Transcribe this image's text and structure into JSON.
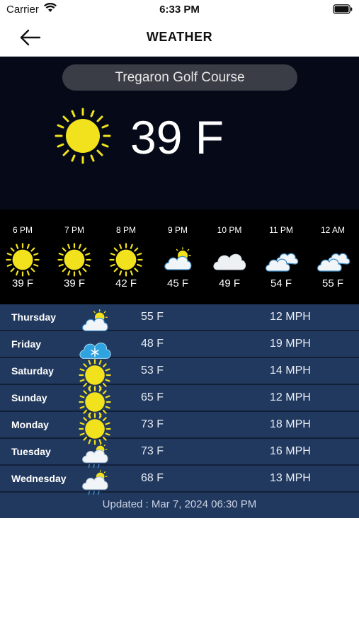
{
  "status_bar": {
    "carrier": "Carrier",
    "time": "6:33 PM"
  },
  "header": {
    "title": "WEATHER"
  },
  "current": {
    "location": "Tregaron Golf Course",
    "temperature": "39 F",
    "icon": "sun-icon"
  },
  "hourly": [
    {
      "time": "6 PM",
      "temp": "39 F",
      "icon": "sun-icon"
    },
    {
      "time": "7 PM",
      "temp": "39 F",
      "icon": "sun-icon"
    },
    {
      "time": "8 PM",
      "temp": "42 F",
      "icon": "sun-icon"
    },
    {
      "time": "9 PM",
      "temp": "45 F",
      "icon": "partly-cloudy-icon"
    },
    {
      "time": "10 PM",
      "temp": "49 F",
      "icon": "cloud-icon"
    },
    {
      "time": "11 PM",
      "temp": "54 F",
      "icon": "clouds-icon"
    },
    {
      "time": "12 AM",
      "temp": "55 F",
      "icon": "clouds-icon"
    }
  ],
  "daily": [
    {
      "day": "Thursday",
      "temp": "55 F",
      "wind": "12 MPH",
      "icon": "partly-cloudy-icon"
    },
    {
      "day": "Friday",
      "temp": "48 F",
      "wind": "19 MPH",
      "icon": "snow-cloud-icon"
    },
    {
      "day": "Saturday",
      "temp": "53 F",
      "wind": "14 MPH",
      "icon": "sun-icon"
    },
    {
      "day": "Sunday",
      "temp": "65 F",
      "wind": "12 MPH",
      "icon": "sun-icon"
    },
    {
      "day": "Monday",
      "temp": "73 F",
      "wind": "18 MPH",
      "icon": "sun-icon"
    },
    {
      "day": "Tuesday",
      "temp": "73 F",
      "wind": "16 MPH",
      "icon": "rain-partly-cloudy-icon"
    },
    {
      "day": "Wednesday",
      "temp": "68 F",
      "wind": "13 MPH",
      "icon": "rain-partly-cloudy-icon"
    }
  ],
  "updated": "Updated : Mar 7, 2024 06:30 PM",
  "colors": {
    "hero_bg": "#060a18",
    "hourly_bg": "#000000",
    "daily_bg": "#22395f",
    "sun": "#f2e21d"
  }
}
